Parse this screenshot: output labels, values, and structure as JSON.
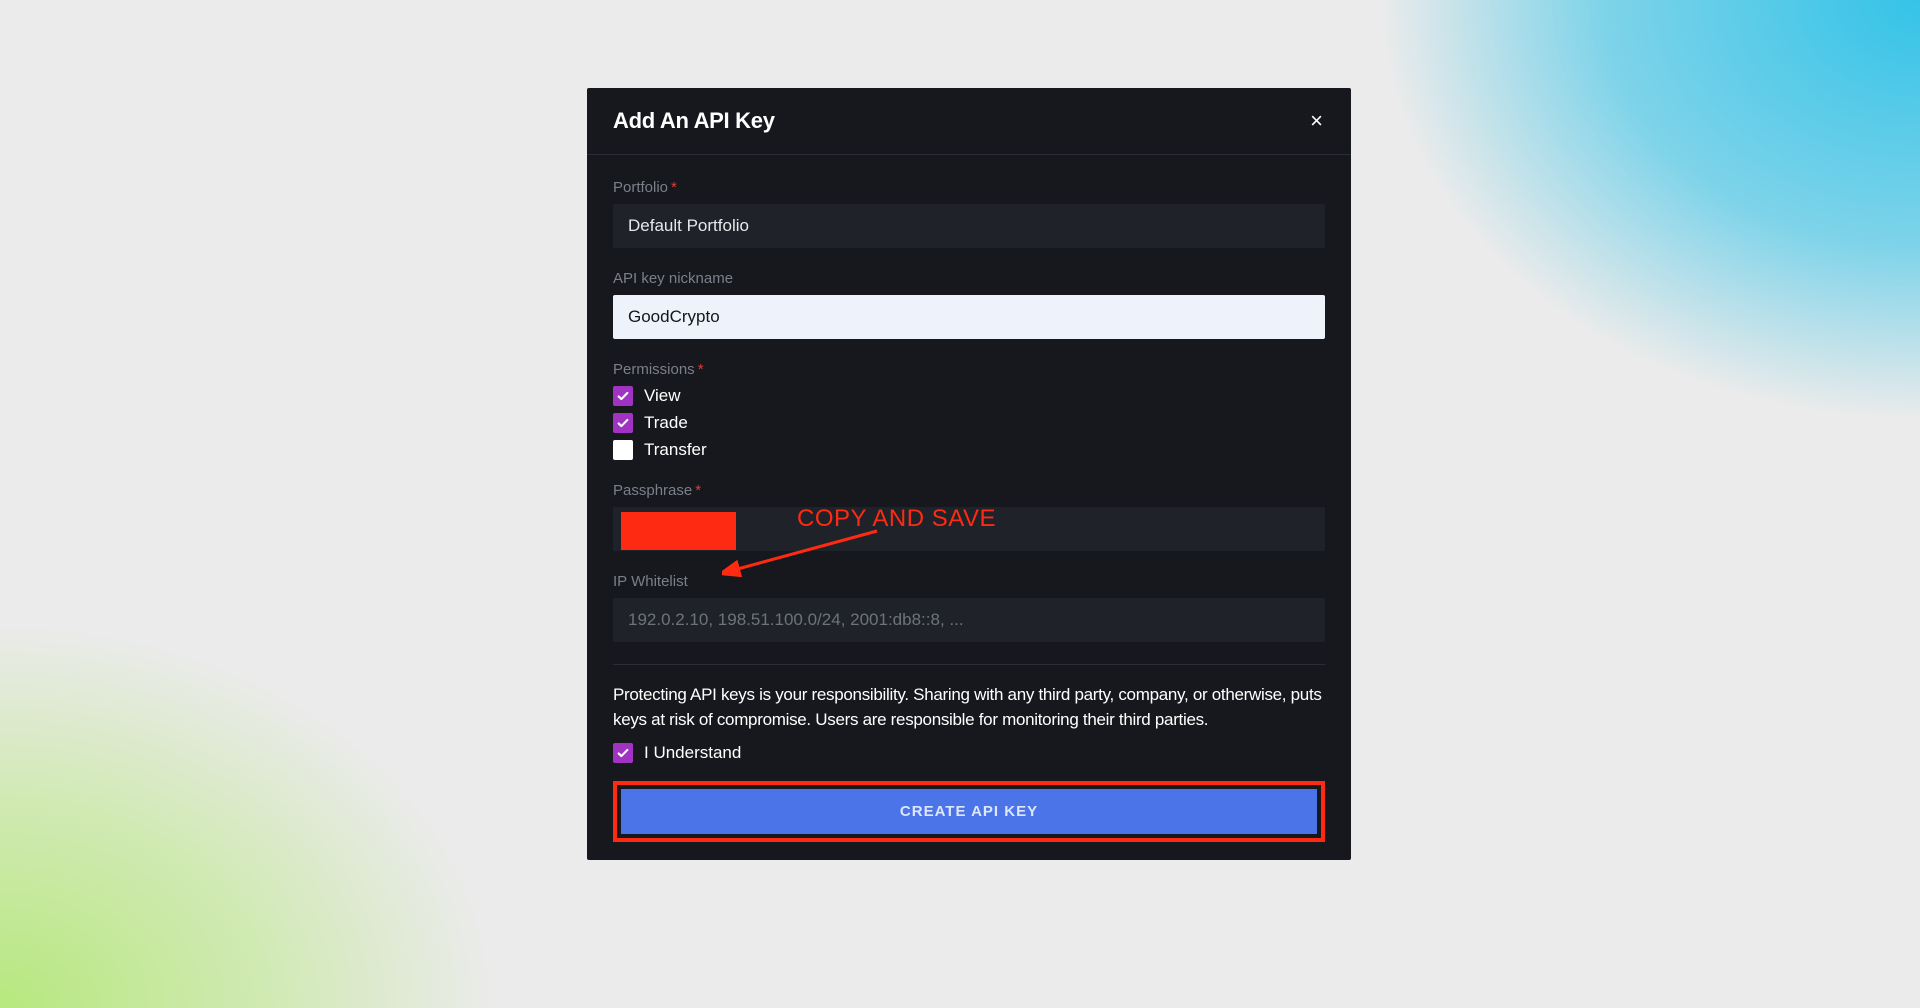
{
  "modal": {
    "title": "Add An API Key",
    "close_glyph": "×"
  },
  "fields": {
    "portfolio": {
      "label": "Portfolio",
      "value": "Default Portfolio"
    },
    "nickname": {
      "label": "API key nickname",
      "value": "GoodCrypto"
    },
    "permissions": {
      "label": "Permissions",
      "items": {
        "view": "View",
        "trade": "Trade",
        "transfer": "Transfer"
      }
    },
    "passphrase": {
      "label": "Passphrase"
    },
    "ip_whitelist": {
      "label": "IP Whitelist",
      "placeholder": "192.0.2.10, 198.51.100.0/24, 2001:db8::8, ..."
    }
  },
  "disclaimer": "Protecting API keys is your responsibility. Sharing with any third party, company, or otherwise, puts keys at risk of compromise. Users are responsible for monitoring their third parties.",
  "understand_label": "I Understand",
  "submit_label": "CREATE API KEY",
  "annotation_text": "COPY AND SAVE"
}
